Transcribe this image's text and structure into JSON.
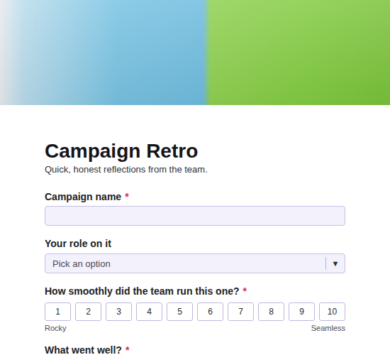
{
  "form": {
    "title": "Campaign Retro",
    "subtitle": "Quick, honest reflections from the team.",
    "required_mark": "*"
  },
  "fields": [
    {
      "kind": "text",
      "label": "Campaign name",
      "required": true,
      "value": ""
    },
    {
      "kind": "select",
      "label": "Your role on it",
      "required": false,
      "placeholder": "Pick an option",
      "caret": "▼"
    },
    {
      "kind": "scale",
      "label": "How smoothly did the team run this one?",
      "required": true,
      "options": [
        {
          "label": "1",
          "selected": false
        },
        {
          "label": "2",
          "selected": false
        },
        {
          "label": "3",
          "selected": false
        },
        {
          "label": "4",
          "selected": false
        },
        {
          "label": "5",
          "selected": false
        },
        {
          "label": "6",
          "selected": false
        },
        {
          "label": "7",
          "selected": false
        },
        {
          "label": "8",
          "selected": false
        },
        {
          "label": "9",
          "selected": false
        },
        {
          "label": "10",
          "selected": false
        }
      ],
      "min_label": "Rocky",
      "max_label": "Seamless"
    },
    {
      "kind": "textarea",
      "label": "What went well?",
      "required": true,
      "value": ""
    }
  ]
}
